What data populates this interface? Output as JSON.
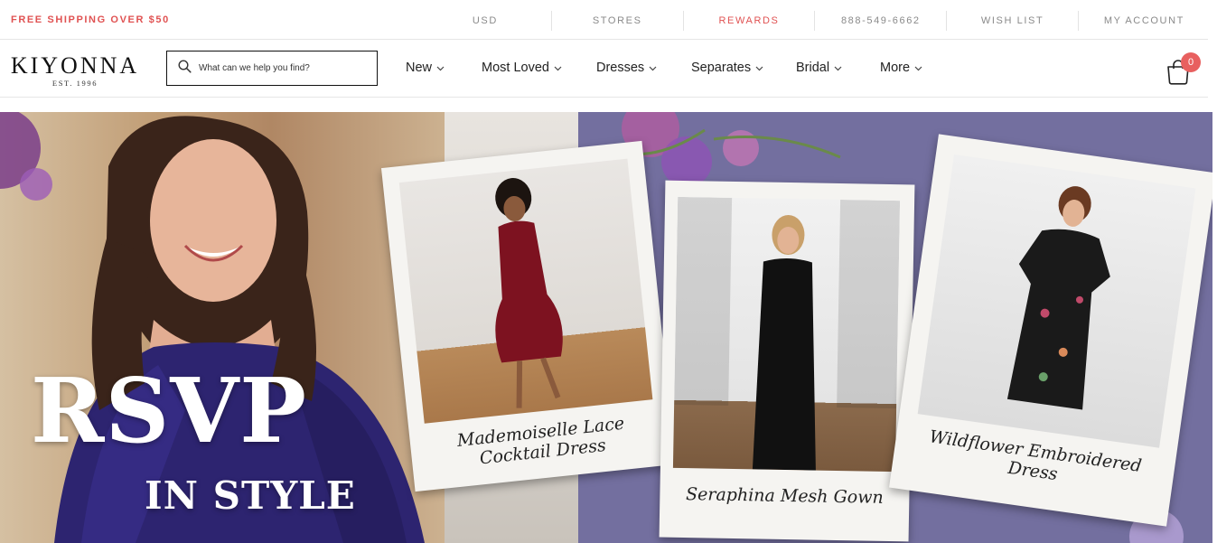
{
  "topbar": {
    "promo": "FREE SHIPPING OVER $50",
    "links": [
      {
        "label": "USD",
        "accent": false
      },
      {
        "label": "STORES",
        "accent": false
      },
      {
        "label": "REWARDS",
        "accent": true
      },
      {
        "label": "888-549-6662",
        "accent": false
      },
      {
        "label": "WISH LIST",
        "accent": false
      },
      {
        "label": "MY ACCOUNT",
        "accent": false
      }
    ],
    "accent_color": "#e05252"
  },
  "header": {
    "logo": {
      "name": "KIYONNA",
      "est": "EST. 1996"
    },
    "search": {
      "placeholder": "What can we help you find?",
      "icon": "search-icon"
    },
    "nav": [
      {
        "label": "New"
      },
      {
        "label": "Most Loved"
      },
      {
        "label": "Dresses"
      },
      {
        "label": "Separates"
      },
      {
        "label": "Bridal"
      },
      {
        "label": "More"
      }
    ],
    "cart": {
      "icon": "shopping-bag-icon",
      "count": "0",
      "badge_color": "#e8605f"
    }
  },
  "hero": {
    "headline": "RSVP",
    "subheadline": "IN STYLE",
    "background_color": "#736f9f",
    "polaroids": [
      {
        "caption_line1": "Mademoiselle Lace",
        "caption_line2": "Cocktail Dress",
        "dress_color": "#7d1220"
      },
      {
        "caption_line1": "Seraphina Mesh Gown",
        "caption_line2": "",
        "dress_color": "#111111"
      },
      {
        "caption_line1": "Wildflower Embroidered",
        "caption_line2": "Dress",
        "dress_color": "#1a1a1a"
      }
    ]
  }
}
